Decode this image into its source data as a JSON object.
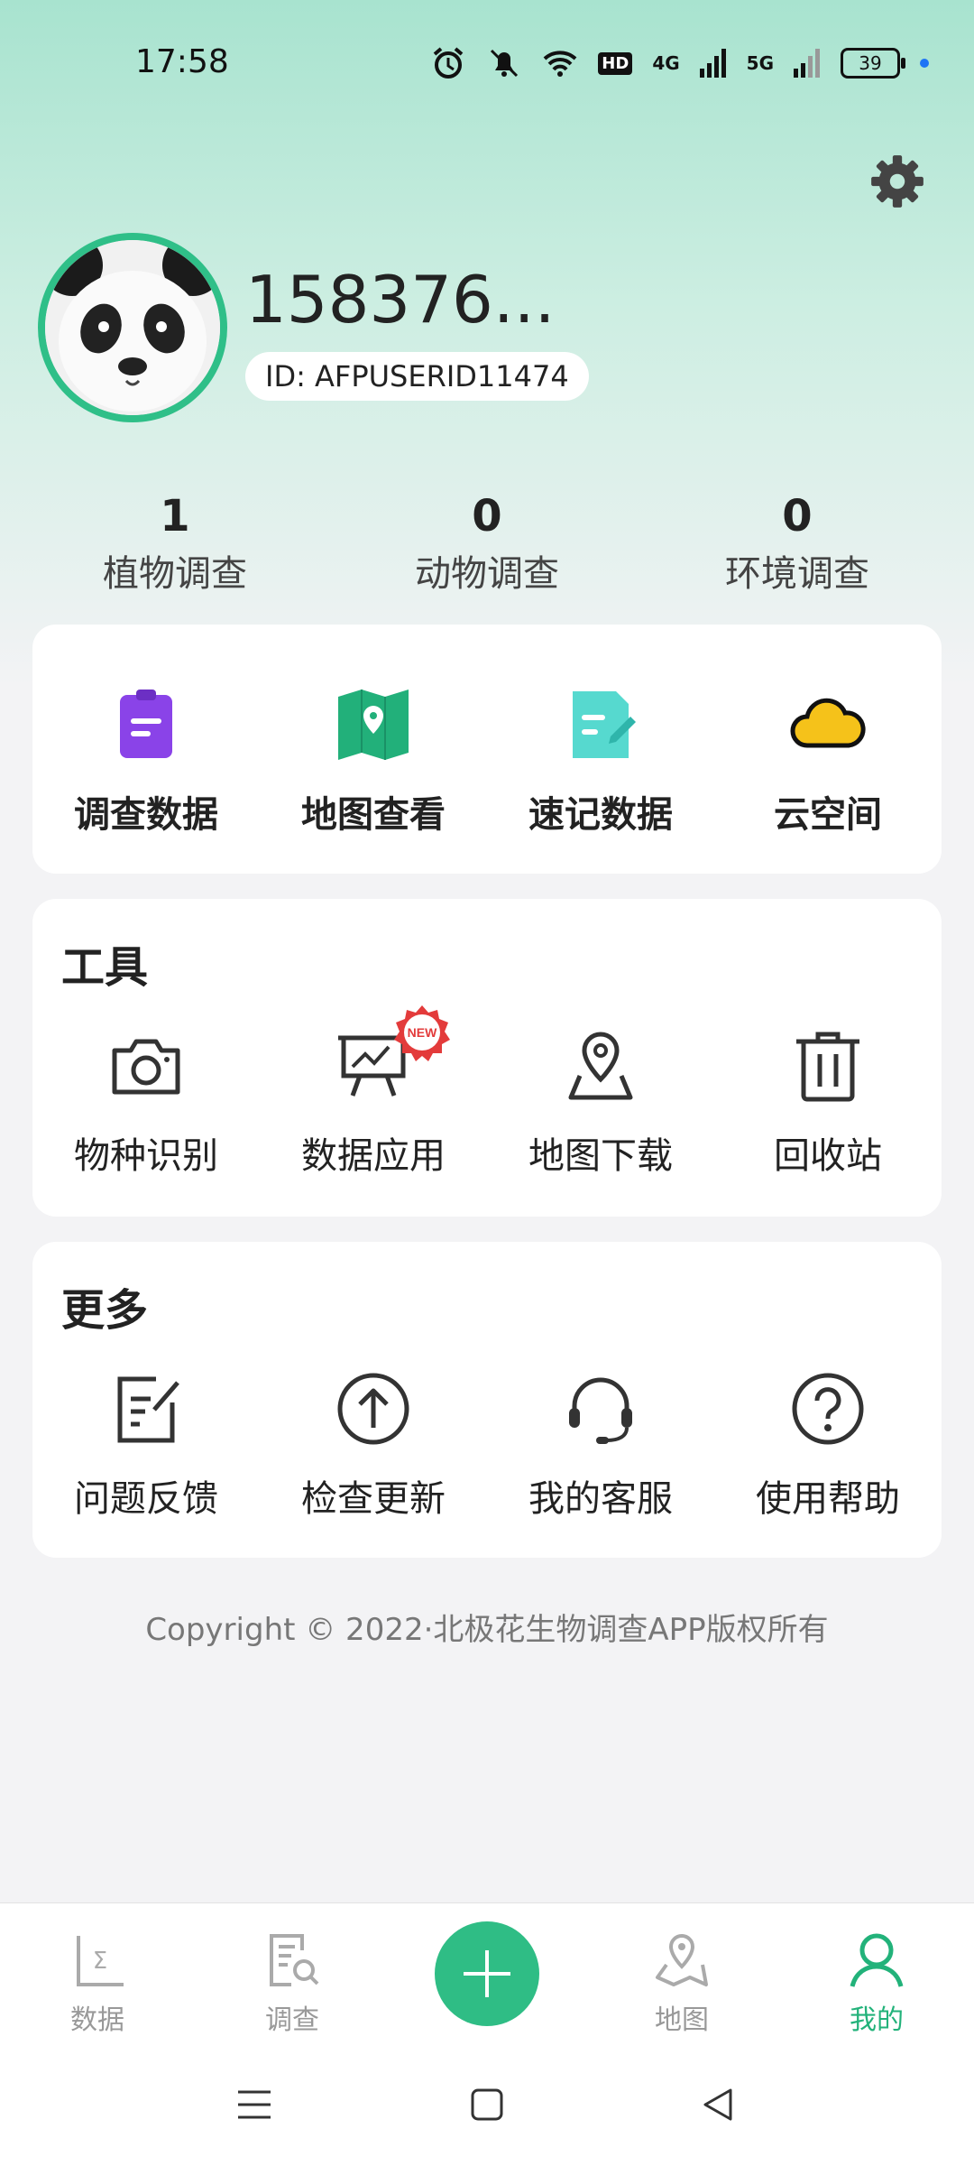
{
  "status_bar": {
    "time": "17:58",
    "net1": "4G",
    "net2": "5G",
    "hd": "HD",
    "battery": "39"
  },
  "profile": {
    "username": "158376...",
    "user_id": "ID: AFPUSERID11474"
  },
  "stats": [
    {
      "value": "1",
      "label": "植物调查"
    },
    {
      "value": "0",
      "label": "动物调查"
    },
    {
      "value": "0",
      "label": "环境调查"
    }
  ],
  "quick_actions": [
    {
      "label": "调查数据",
      "icon": "clipboard-icon",
      "color": "#8a43e8"
    },
    {
      "label": "地图查看",
      "icon": "map-icon",
      "color": "#22b07a"
    },
    {
      "label": "速记数据",
      "icon": "note-edit-icon",
      "color": "#56d9cf"
    },
    {
      "label": "云空间",
      "icon": "cloud-icon",
      "color": "#f5c21a"
    }
  ],
  "tools": {
    "title": "工具",
    "items": [
      {
        "label": "物种识别",
        "icon": "camera-icon"
      },
      {
        "label": "数据应用",
        "icon": "presentation-chart-icon",
        "badge": "NEW"
      },
      {
        "label": "地图下载",
        "icon": "map-pin-icon"
      },
      {
        "label": "回收站",
        "icon": "trash-icon"
      }
    ]
  },
  "more": {
    "title": "更多",
    "items": [
      {
        "label": "问题反馈",
        "icon": "feedback-edit-icon"
      },
      {
        "label": "检查更新",
        "icon": "arrow-up-circle-icon"
      },
      {
        "label": "我的客服",
        "icon": "headset-icon"
      },
      {
        "label": "使用帮助",
        "icon": "question-circle-icon"
      }
    ]
  },
  "copyright": "Copyright © 2022·北极花生物调查APP版权所有",
  "tabbar": {
    "items": [
      {
        "label": "数据",
        "icon": "sigma-chart-icon"
      },
      {
        "label": "调查",
        "icon": "survey-search-icon"
      },
      {
        "label": "",
        "icon": "plus-icon"
      },
      {
        "label": "地图",
        "icon": "map-location-icon"
      },
      {
        "label": "我的",
        "icon": "user-icon",
        "active": true
      }
    ],
    "accent": "#22b27a"
  }
}
